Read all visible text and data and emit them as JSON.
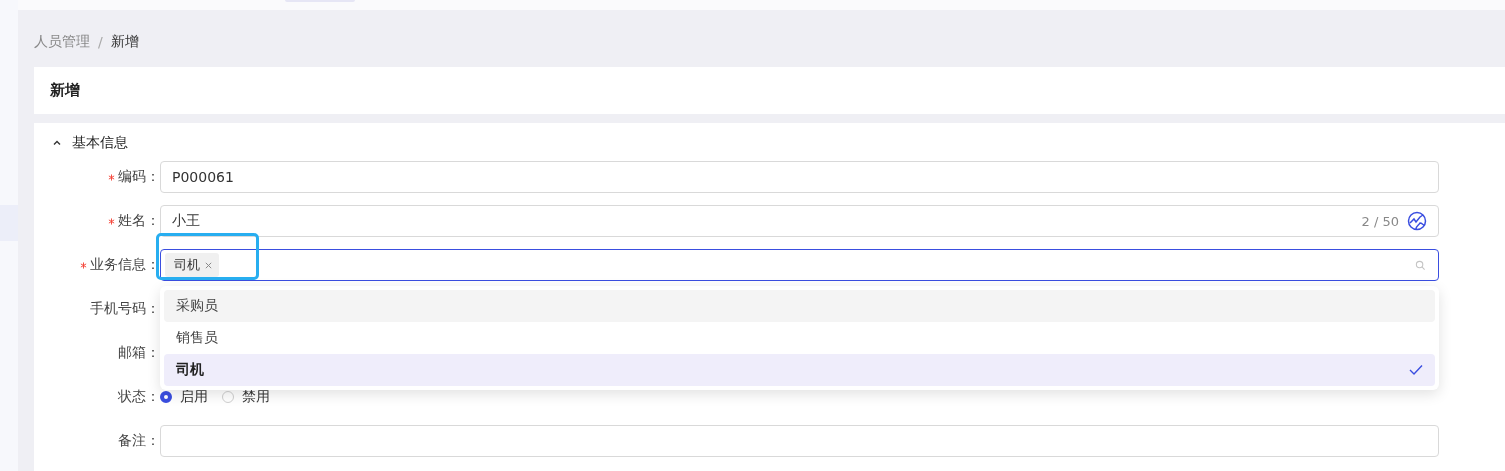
{
  "breadcrumb": {
    "items": [
      "人员管理",
      "新增"
    ],
    "separator": "/"
  },
  "page_title": "新增",
  "section": {
    "title": "基本信息",
    "expanded": true
  },
  "fields": [
    {
      "kind": "text",
      "label": "编码：",
      "required": true,
      "value": "P000061"
    },
    {
      "kind": "text",
      "label": "姓名：",
      "required": true,
      "value": "小王",
      "counter": "2 / 50"
    },
    {
      "kind": "select",
      "label": "业务信息：",
      "required": true,
      "tags": [
        "司机"
      ]
    },
    {
      "kind": "covered",
      "label": "手机号码：",
      "required": false
    },
    {
      "kind": "covered",
      "label": "邮箱：",
      "required": false
    },
    {
      "kind": "radio",
      "label": "状态：",
      "required": false,
      "options": [
        {
          "label": "启用",
          "selected": true
        },
        {
          "label": "禁用",
          "selected": false
        }
      ]
    },
    {
      "kind": "text",
      "label": "备注：",
      "required": false
    }
  ],
  "dropdown": {
    "options": [
      {
        "label": "采购员",
        "selected": false,
        "hovered": true
      },
      {
        "label": "销售员",
        "selected": false,
        "hovered": false
      },
      {
        "label": "司机",
        "selected": true,
        "hovered": false
      }
    ]
  }
}
